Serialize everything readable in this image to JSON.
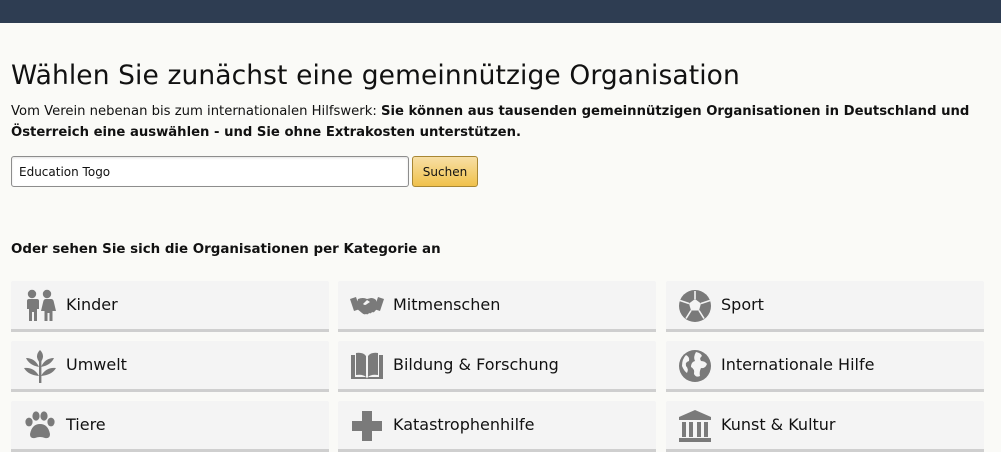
{
  "page": {
    "title": "Wählen Sie zunächst eine gemeinnützige Organisation",
    "intro_plain": "Vom Verein nebenan bis zum internationalen Hilfswerk: ",
    "intro_bold": "Sie können aus tausenden gemeinnützigen Organisationen in Deutschland und Österreich eine auswählen - und Sie ohne Extrakosten unterstützen."
  },
  "search": {
    "value": "Education Togo",
    "button_label": "Suchen"
  },
  "categories": {
    "heading": "Oder sehen Sie sich die Organisationen per Kategorie an",
    "icon_color": "#7a7a7a",
    "items": [
      {
        "label": "Kinder",
        "icon": "children-icon"
      },
      {
        "label": "Mitmenschen",
        "icon": "handshake-icon"
      },
      {
        "label": "Sport",
        "icon": "soccer-ball-icon"
      },
      {
        "label": "Umwelt",
        "icon": "plant-icon"
      },
      {
        "label": "Bildung & Forschung",
        "icon": "book-icon"
      },
      {
        "label": "Internationale Hilfe",
        "icon": "globe-icon"
      },
      {
        "label": "Tiere",
        "icon": "paw-icon"
      },
      {
        "label": "Katastrophenhilfe",
        "icon": "cross-icon"
      },
      {
        "label": "Kunst & Kultur",
        "icon": "museum-icon"
      }
    ]
  }
}
